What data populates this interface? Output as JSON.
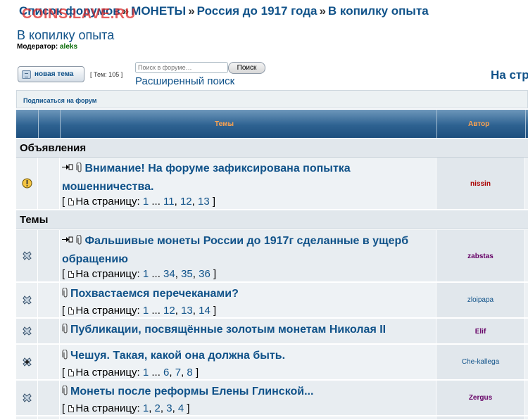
{
  "breadcrumb": {
    "items": [
      "Список форумов",
      "МОНЕТЫ",
      "Россия до 1917 года",
      "В копилку опыта"
    ],
    "separator": "»"
  },
  "watermark": "COINS.LAVE.RU",
  "forum": {
    "title": "В копилку опыта",
    "moderator_label": "Модератор:",
    "moderator_name": "aleks"
  },
  "toolbar": {
    "new_topic_label": "новая тема",
    "topics_count": "[ Тем: 105 ]",
    "search_placeholder": "Поиск в форуме…",
    "search_button": "Поиск",
    "advanced_search": "Расширенный поиск",
    "pagination_label": "На стр"
  },
  "subscribe": "Подписаться на форум",
  "table": {
    "col_topics": "Темы",
    "col_author": "Автор"
  },
  "sections": {
    "announcements": "Объявления",
    "topics": "Темы"
  },
  "pages_prefix": "[",
  "pages_label": "На страницу:",
  "pages_suffix": "]",
  "rows": [
    {
      "title": "Внимание! На форуме зафиксирована попытка мошенничества.",
      "pages": [
        "1",
        "...",
        "11",
        "12",
        "13"
      ],
      "author": "nissin",
      "icon": "announcement-icon",
      "has_attachment": true,
      "has_goto": true
    },
    {
      "title": "Фальшивые монеты России до 1917г сделанные в ущерб обращению",
      "pages": [
        "1",
        "...",
        "34",
        "35",
        "36"
      ],
      "author": "zabstas",
      "icon": "hot-topic-icon",
      "has_attachment": true,
      "has_goto": true
    },
    {
      "title": "Похвастаемся перечеканами?",
      "pages": [
        "1",
        "...",
        "12",
        "13",
        "14"
      ],
      "author": "zloipapa",
      "icon": "hot-topic-icon",
      "has_attachment": true,
      "has_goto": false
    },
    {
      "title": "Публикации, посвящённые золотым монетам Николая II",
      "pages": [],
      "author": "Elif",
      "icon": "hot-topic-icon",
      "has_attachment": true,
      "has_goto": false
    },
    {
      "title": "Чешуя. Такая, какой она должна быть.",
      "pages": [
        "1",
        "...",
        "6",
        "7",
        "8"
      ],
      "author": "Che-kallega",
      "icon": "hot-topic-posted-icon",
      "has_attachment": true,
      "has_goto": false
    },
    {
      "title": "Монеты после реформы Елены Глинской...",
      "pages": [
        "1",
        "2",
        "3",
        "4"
      ],
      "author": "Zergus",
      "icon": "hot-topic-icon",
      "has_attachment": true,
      "has_goto": false
    }
  ]
}
